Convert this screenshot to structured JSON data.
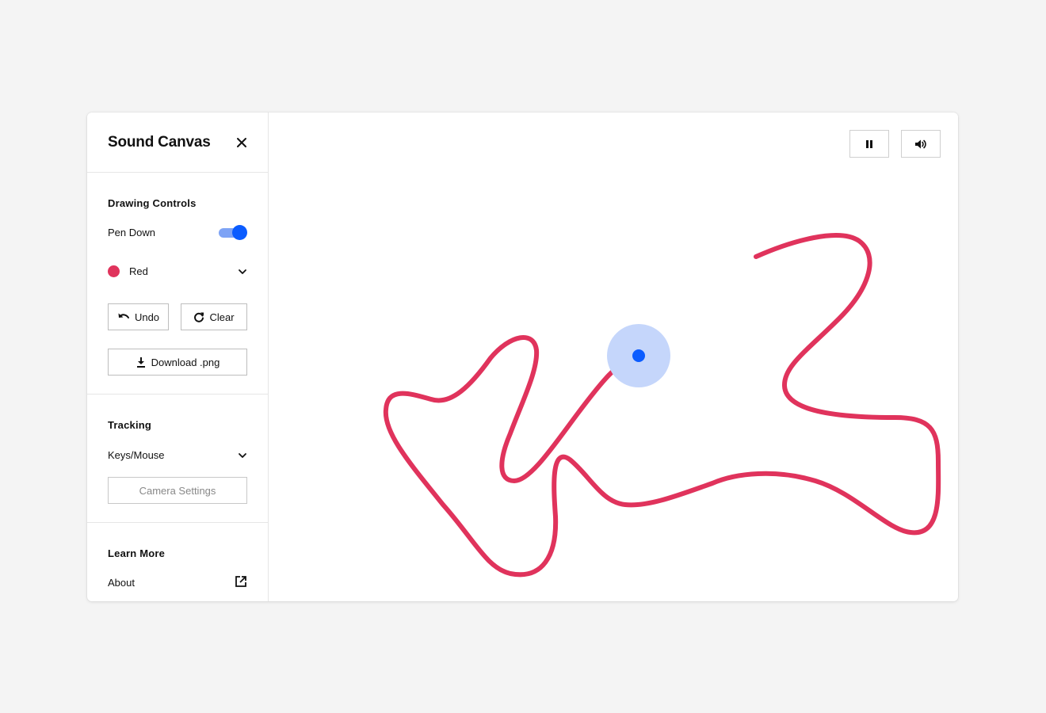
{
  "app": {
    "title": "Sound Canvas"
  },
  "sidebar": {
    "drawing_controls": {
      "title": "Drawing Controls",
      "pen_down_label": "Pen Down",
      "pen_down_on": true,
      "color_label": "Red",
      "color_value": "#e0335c",
      "undo_label": "Undo",
      "clear_label": "Clear",
      "download_label": "Download .png"
    },
    "tracking": {
      "title": "Tracking",
      "mode_label": "Keys/Mouse",
      "camera_settings_label": "Camera Settings"
    },
    "learn_more": {
      "title": "Learn More",
      "about_label": "About"
    }
  },
  "toolbar": {
    "pause_icon": "pause-icon",
    "volume_icon": "volume-icon"
  },
  "colors": {
    "accent": "#0b5cff",
    "accent_light": "#7ea3f5",
    "cursor_halo": "#c5d6fb",
    "stroke": "#e0335c",
    "background": "#f4f4f4"
  }
}
